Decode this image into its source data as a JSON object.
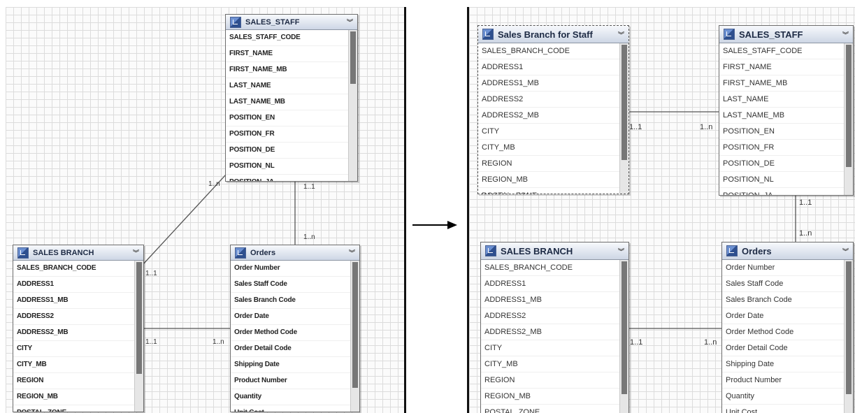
{
  "left": {
    "sales_staff": {
      "title": "SALES_STAFF",
      "rows": [
        "SALES_STAFF_CODE",
        "FIRST_NAME",
        "FIRST_NAME_MB",
        "LAST_NAME",
        "LAST_NAME_MB",
        "POSITION_EN",
        "POSITION_FR",
        "POSITION_DE",
        "POSITION_NL",
        "POSITION_JA"
      ]
    },
    "sales_branch": {
      "title": "SALES BRANCH",
      "rows": [
        "SALES_BRANCH_CODE",
        "ADDRESS1",
        "ADDRESS1_MB",
        "ADDRESS2",
        "ADDRESS2_MB",
        "CITY",
        "CITY_MB",
        "REGION",
        "REGION_MB",
        "POSTAL_ZONE"
      ]
    },
    "orders": {
      "title": "Orders",
      "rows": [
        "Order Number",
        "Sales Staff Code",
        "Sales Branch Code",
        "Order Date",
        "Order Method Code",
        "Order Detail Code",
        "Shipping Date",
        "Product Number",
        "Quantity",
        "Unit Cost"
      ]
    },
    "cardinalities": {
      "branch_staff_branch": "1..1",
      "branch_staff_staff": "1..n",
      "staff_orders_staff": "1..1",
      "staff_orders_orders": "1..n",
      "branch_orders_branch": "1..1",
      "branch_orders_orders": "1..n"
    }
  },
  "right": {
    "branch_for_staff": {
      "title": "Sales Branch for Staff",
      "rows": [
        "SALES_BRANCH_CODE",
        "ADDRESS1",
        "ADDRESS1_MB",
        "ADDRESS2",
        "ADDRESS2_MB",
        "CITY",
        "CITY_MB",
        "REGION",
        "REGION_MB",
        "POSTAL_ZONE"
      ]
    },
    "sales_staff": {
      "title": "SALES_STAFF",
      "rows": [
        "SALES_STAFF_CODE",
        "FIRST_NAME",
        "FIRST_NAME_MB",
        "LAST_NAME",
        "LAST_NAME_MB",
        "POSITION_EN",
        "POSITION_FR",
        "POSITION_DE",
        "POSITION_NL",
        "POSITION_JA"
      ]
    },
    "sales_branch": {
      "title": "SALES BRANCH",
      "rows": [
        "SALES_BRANCH_CODE",
        "ADDRESS1",
        "ADDRESS1_MB",
        "ADDRESS2",
        "ADDRESS2_MB",
        "CITY",
        "CITY_MB",
        "REGION",
        "REGION_MB",
        "POSTAL_ZONE"
      ]
    },
    "orders": {
      "title": "Orders",
      "rows": [
        "Order Number",
        "Sales Staff Code",
        "Sales Branch Code",
        "Order Date",
        "Order Method Code",
        "Order Detail Code",
        "Shipping Date",
        "Product Number",
        "Quantity",
        "Unit Cost"
      ]
    },
    "cardinalities": {
      "bfs_staff_branch": "1..1",
      "bfs_staff_staff": "1..n",
      "staff_orders_staff": "1..1",
      "staff_orders_orders": "1..n",
      "branch_orders_branch": "1..1",
      "branch_orders_orders": "1..n"
    }
  },
  "icons": {
    "entity": "query-subject-icon",
    "collapse": "chevron-double-down-icon",
    "transform": "right-arrow-icon"
  }
}
